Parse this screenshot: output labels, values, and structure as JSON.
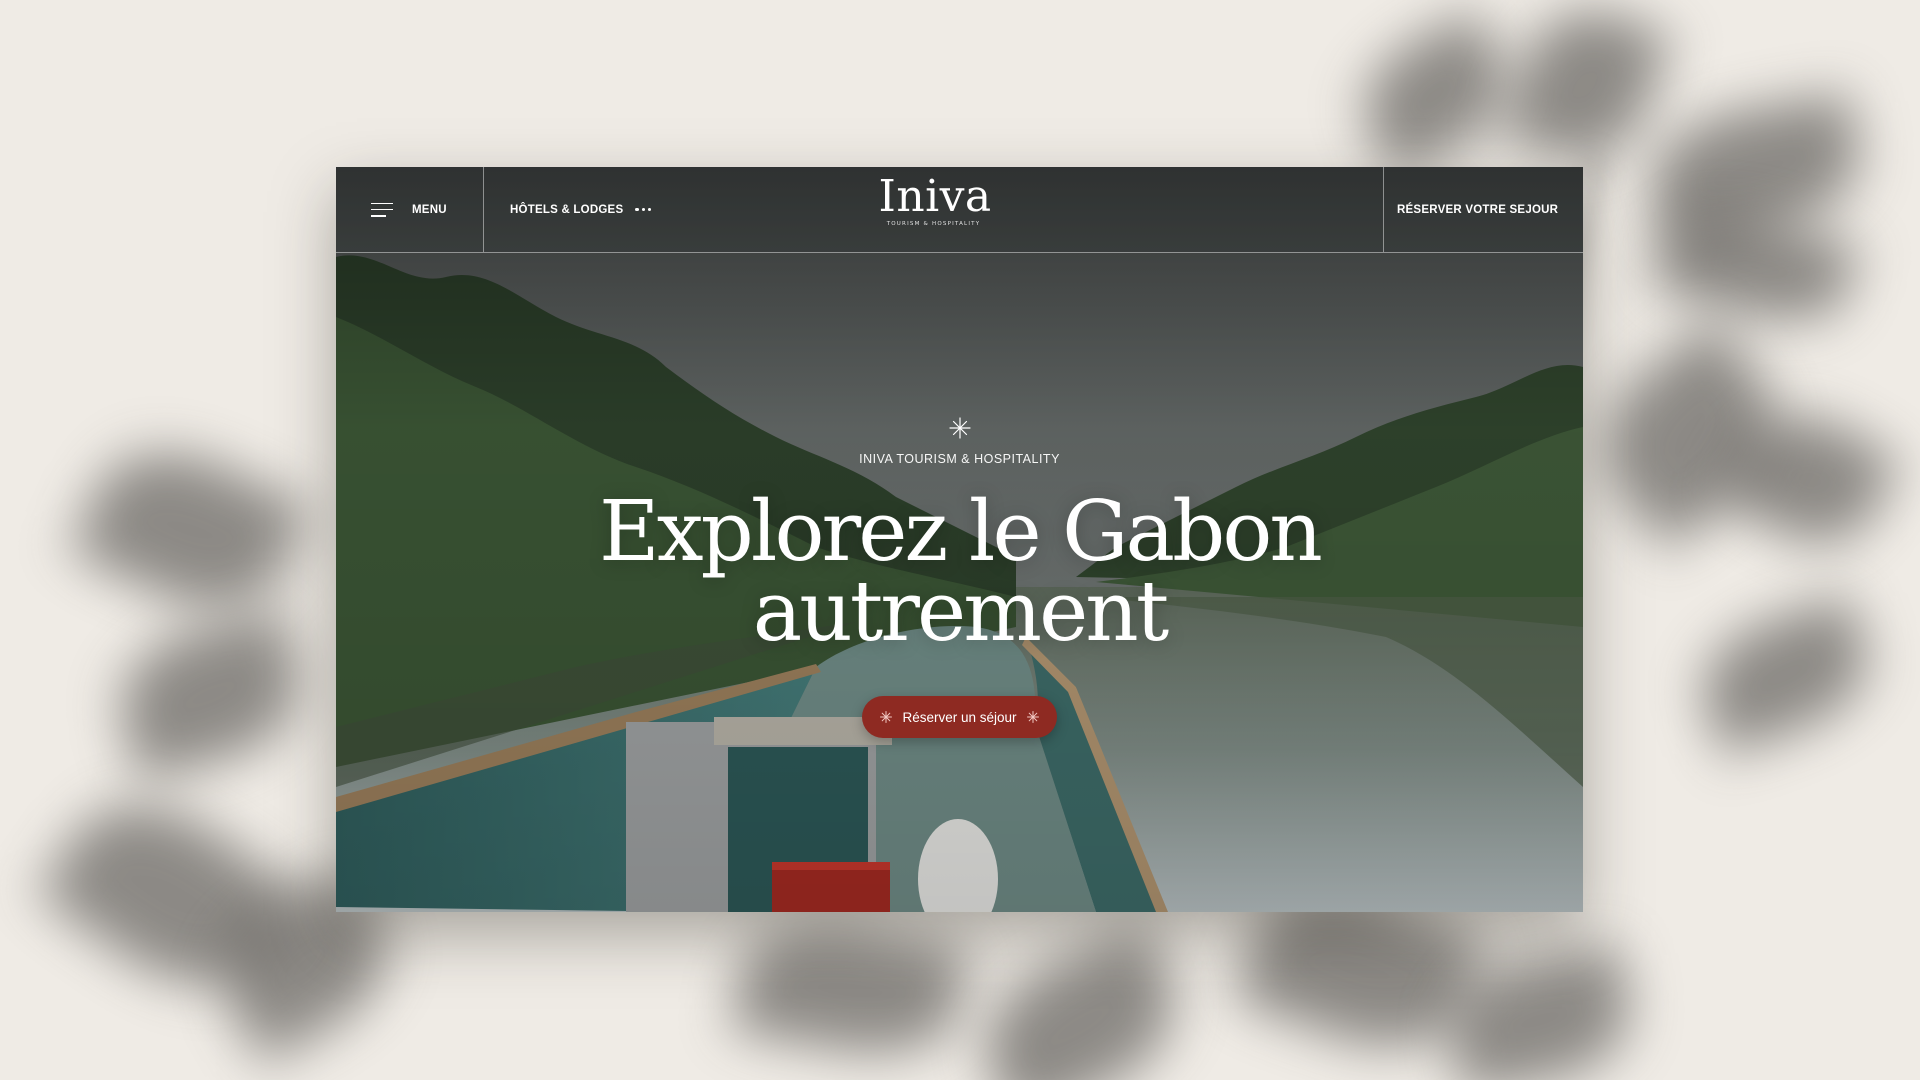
{
  "header": {
    "menu_label": "MENU",
    "hotels_label": "HÔTELS & LODGES",
    "logo_word": "Iniva",
    "logo_tagline": "TOURISM & HOSPITALITY",
    "book_label": "RÉSERVER VOTRE SEJOUR"
  },
  "hero": {
    "eyebrow": "INIVA TOURISM & HOSPITALITY",
    "headline_line1": "Explorez le Gabon",
    "headline_line2": "autrement",
    "cta_label": "Réserver un séjour"
  },
  "colors": {
    "background": "#efebe5",
    "cta": "#8e2a22",
    "header_text": "#ffffff"
  },
  "icons": {
    "menu": "hamburger-icon",
    "hotels_more": "more-dots-icon",
    "sparkle": "sparkle-icon"
  }
}
